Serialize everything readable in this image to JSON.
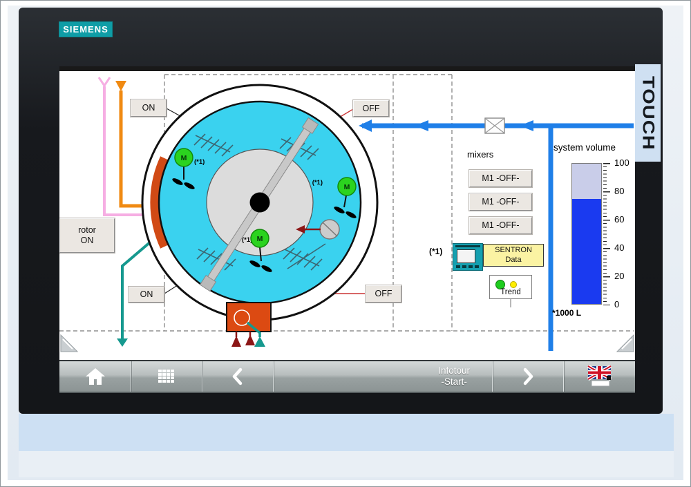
{
  "device": {
    "logo": "SIEMENS",
    "touch_sticker": "TOUCH"
  },
  "colors": {
    "logo_teal": "#0f9da6",
    "tank_cyan": "#3ad2ef",
    "pipe_blue": "#1f7fe8",
    "gauge_fill_blue": "#1a3af0",
    "gauge_empty_lavender": "#c9cde9",
    "mixer_green": "#2bd31f",
    "rotor_orange_red": "#d14a15",
    "line_pink": "#f6aee3",
    "line_orange": "#f08a12",
    "line_teal": "#16998f",
    "drain_dark_red": "#8c1616",
    "sentron_yellow": "#fbf3a3"
  },
  "screen": {
    "buttons": {
      "on_top": "ON",
      "off_top": "OFF",
      "on_bottom": "ON",
      "off_bottom": "OFF"
    },
    "rotor_button": {
      "line1": "rotor",
      "line2": "ON"
    },
    "mixers": {
      "title": "mixers",
      "items": [
        "M1 -OFF-",
        "M1 -OFF-",
        "M1 -OFF-"
      ]
    },
    "ref_marker": "(*1)",
    "mixer_letter": "M",
    "sentron": {
      "line1": "SENTRON",
      "line2": "Data"
    },
    "trend_label": "Trend",
    "gauge": {
      "title": "system volume",
      "unit": "*1000 L",
      "ticks": [
        "100",
        "80",
        "60",
        "40",
        "20",
        "0"
      ],
      "value": 75,
      "max": 100
    }
  },
  "navbar": {
    "infotour_line1": "Infotour",
    "infotour_line2": "-Start-"
  }
}
